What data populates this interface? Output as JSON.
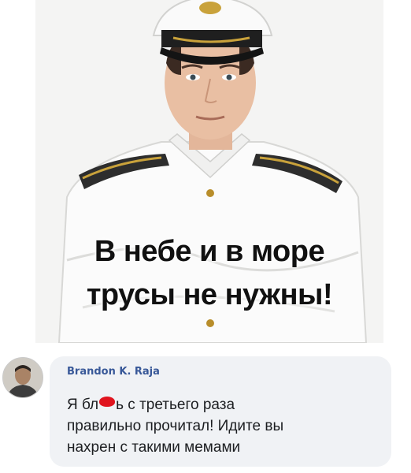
{
  "meme": {
    "caption_line1": "В небе и в море",
    "caption_line2": "трусы не нужны!"
  },
  "comment": {
    "author": "Brandon K. Raja",
    "line1_before": "Я бл",
    "line1_after": "ь с третьего раза",
    "line2": "правильно прочитал! Идите вы",
    "line3": "нахрен с такими мемами"
  },
  "colors": {
    "author_link": "#385898",
    "bubble": "#f0f2f5",
    "censor_mark": "#e0141e"
  }
}
